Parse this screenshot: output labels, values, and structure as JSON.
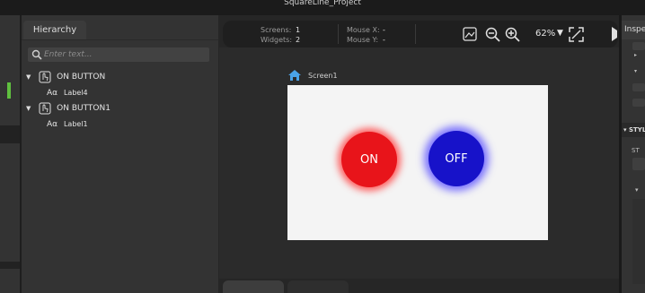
{
  "window": {
    "title": "SquareLine_Project"
  },
  "hierarchy": {
    "tab_label": "Hierarchy",
    "search_placeholder": "Enter text...",
    "items": [
      {
        "label": "ON BUTTON",
        "type": "button",
        "expanded": true,
        "children": [
          {
            "label": "Label4",
            "type": "label"
          }
        ]
      },
      {
        "label": "ON BUTTON1",
        "type": "button",
        "expanded": true,
        "children": [
          {
            "label": "Label1",
            "type": "label"
          }
        ]
      }
    ],
    "label_glyph": "Aα"
  },
  "toolbar": {
    "screens_label": "Screens:",
    "screens_value": "1",
    "widgets_label": "Widgets:",
    "widgets_value": "2",
    "mousex_label": "Mouse X:",
    "mousex_value": "-",
    "mousey_label": "Mouse Y:",
    "mousey_value": "-",
    "zoom_value": "62%"
  },
  "canvas": {
    "screen_name": "Screen1",
    "buttons": [
      {
        "label": "ON",
        "color": "#e8141a"
      },
      {
        "label": "OFF",
        "color": "#1712c9"
      }
    ]
  },
  "inspector": {
    "tab_label": "Inspector",
    "section_label": "STYLE",
    "style_prefix": "ST"
  },
  "colors": {
    "accent_green": "#5fbf3f",
    "panel_bg": "#333333",
    "toolbar_bg": "#1f1f1f"
  }
}
